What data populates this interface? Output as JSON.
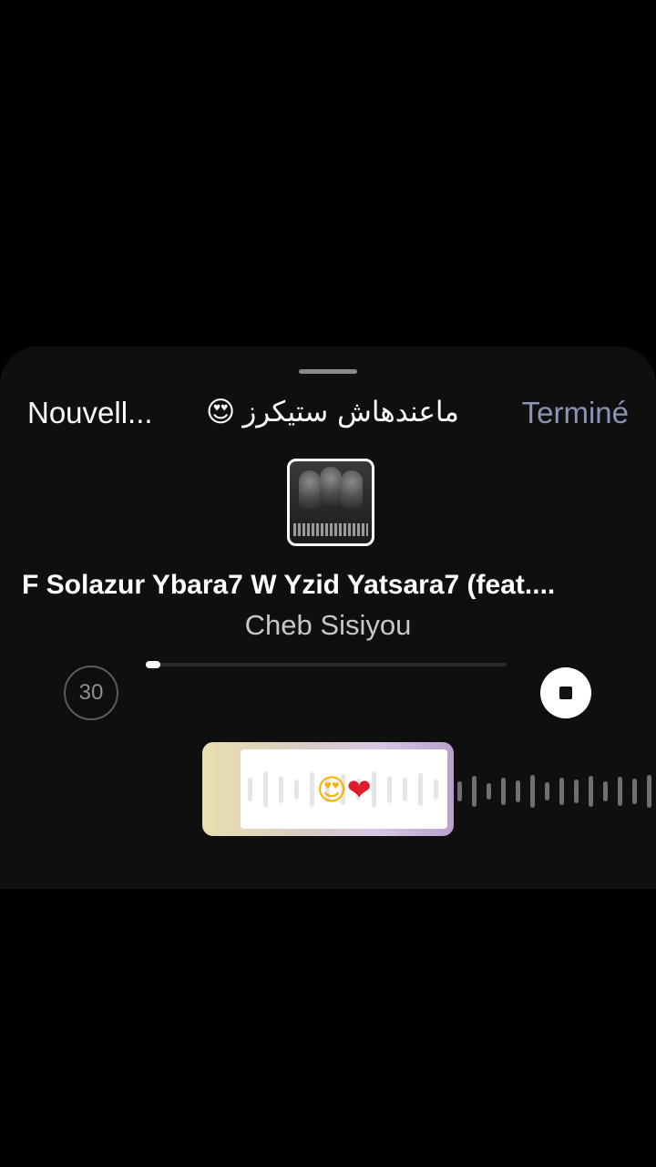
{
  "nav": {
    "left_label": "Nouvell...",
    "center_text": "ماعندهاش ستيكرز",
    "center_emoji": "😍",
    "right_label": "Terminé"
  },
  "song": {
    "title": "F Solazur Ybara7 W Yzid Yatsara7 (feat....",
    "artist": "Cheb Sisiyou"
  },
  "playback": {
    "skip_label": "30",
    "progress": 0.04
  },
  "sticker": {
    "face": "😍",
    "heart": "❤"
  },
  "colors": {
    "accent_done": "#8d93b5",
    "background": "#000000",
    "sheet": "#0f0f10"
  },
  "icons": {
    "stop": "stop-icon",
    "skip": "skip-30-icon"
  }
}
